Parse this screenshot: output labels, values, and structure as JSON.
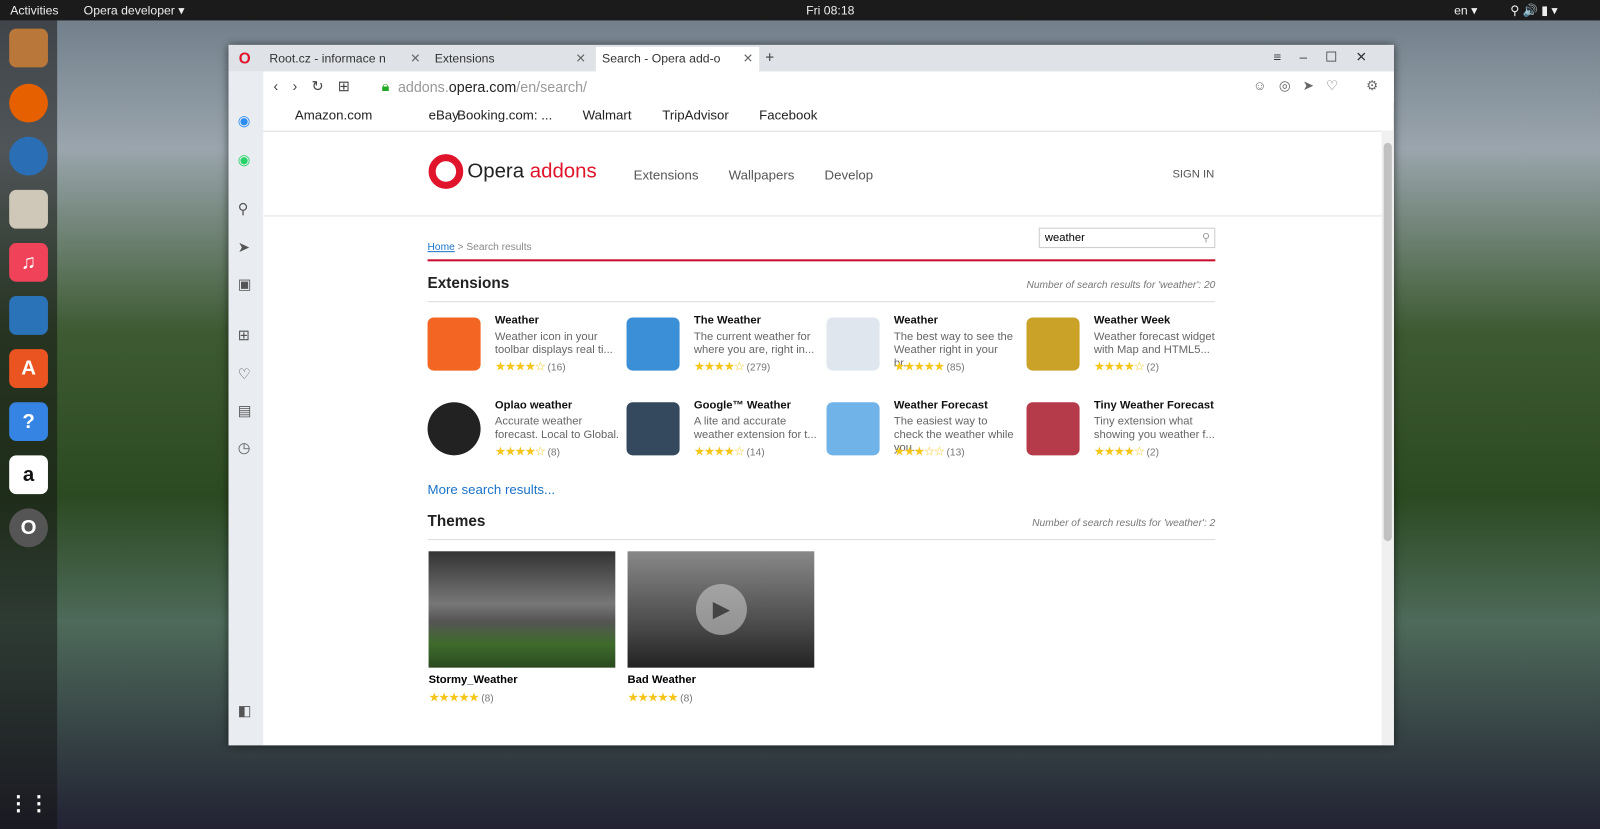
{
  "topbar": {
    "activities": "Activities",
    "app": "Opera developer ▾",
    "clock": "Fri 08:18",
    "lang": "en ▾"
  },
  "tabs": [
    {
      "label": "Root.cz - informace n"
    },
    {
      "label": "Extensions"
    },
    {
      "label": "Search - Opera add-o"
    }
  ],
  "address": {
    "host_pre": "addons.",
    "host": "opera.com",
    "path": "/en/search/"
  },
  "bookmarks": [
    "Amazon.com",
    "eBay",
    "Booking.com: ...",
    "Walmart",
    "TripAdvisor",
    "Facebook"
  ],
  "header": {
    "logo": "Opera",
    "logo2": "addons",
    "nav": [
      "Extensions",
      "Wallpapers",
      "Develop"
    ],
    "signin": "SIGN IN"
  },
  "breadcrumb": {
    "home": "Home",
    "current": " > Search results"
  },
  "search": {
    "value": "weather"
  },
  "extensions": {
    "title": "Extensions",
    "count": "Number of search results for 'weather': 20",
    "items": [
      {
        "title": "Weather",
        "desc": "Weather icon in your toolbar displays real ti...",
        "stars": "★★★★☆",
        "count": "(16)",
        "color": "#f26522"
      },
      {
        "title": "The Weather",
        "desc": "The current weather for where you are, right in...",
        "stars": "★★★★☆",
        "count": "(279)",
        "color": "#3a8fd6"
      },
      {
        "title": "Weather",
        "desc": "The best way to see the Weather right in your br...",
        "stars": "★★★★★",
        "count": "(85)",
        "color": "#dfe6ee"
      },
      {
        "title": "Weather Week",
        "desc": "Weather forecast widget with Map and HTML5...",
        "stars": "★★★★☆",
        "count": "(2)",
        "color": "#c9a227"
      },
      {
        "title": "Oplao weather",
        "desc": "Accurate weather forecast. Local to Global.",
        "stars": "★★★★☆",
        "count": "(8)",
        "color": "#222222"
      },
      {
        "title": "Google™ Weather",
        "desc": "A lite and accurate weather extension for t...",
        "stars": "★★★★☆",
        "count": "(14)",
        "color": "#34495e"
      },
      {
        "title": "Weather Forecast",
        "desc": "The easiest way to check the weather while you...",
        "stars": "★★★☆☆",
        "count": "(13)",
        "color": "#6fb3e8"
      },
      {
        "title": "Tiny Weather Forecast",
        "desc": "Tiny extension what showing you weather f...",
        "stars": "★★★★☆",
        "count": "(2)",
        "color": "#b53a4a"
      }
    ],
    "more": "More search results..."
  },
  "themes": {
    "title": "Themes",
    "count": "Number of search results for 'weather': 2",
    "items": [
      {
        "title": "Stormy_Weather",
        "stars": "★★★★★",
        "count": "(8)"
      },
      {
        "title": "Bad Weather",
        "stars": "★★★★★",
        "count": "(8)"
      }
    ]
  }
}
